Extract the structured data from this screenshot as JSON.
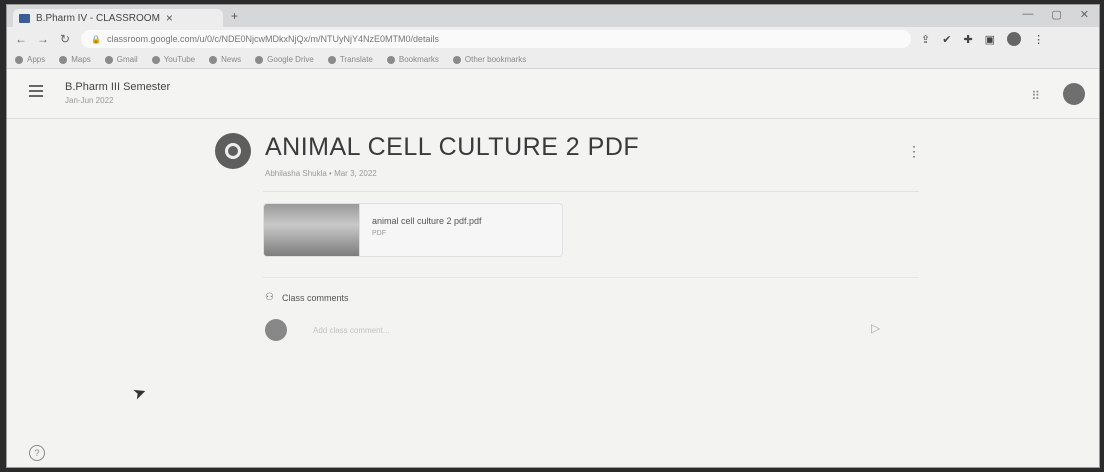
{
  "browser": {
    "tab_title": "B.Pharm IV - CLASSROOM",
    "tab_close": "×",
    "new_tab": "+",
    "url": "classroom.google.com/u/0/c/NDE0NjcwMDkxNjQx/m/NTUyNjY4NzE0MTM0/details",
    "bookmarks": [
      "Apps",
      "Maps",
      "Gmail",
      "YouTube",
      "News",
      "Google Drive",
      "Translate",
      "Bookmarks",
      "Other bookmarks"
    ]
  },
  "header": {
    "class_name": "B.Pharm III Semester",
    "class_section": "Jan-Jun 2022"
  },
  "post": {
    "title": "ANIMAL CELL CULTURE 2 PDF",
    "meta": "Abhilasha Shukla • Mar 3, 2022",
    "attachment": {
      "name": "animal cell culture 2 pdf.pdf",
      "type": "PDF"
    }
  },
  "comments": {
    "heading": "Class comments",
    "placeholder": "Add class comment..."
  },
  "icons": {
    "more": "⋮",
    "apps": "⠿",
    "send": "▷",
    "help": "?",
    "people": "👥"
  }
}
